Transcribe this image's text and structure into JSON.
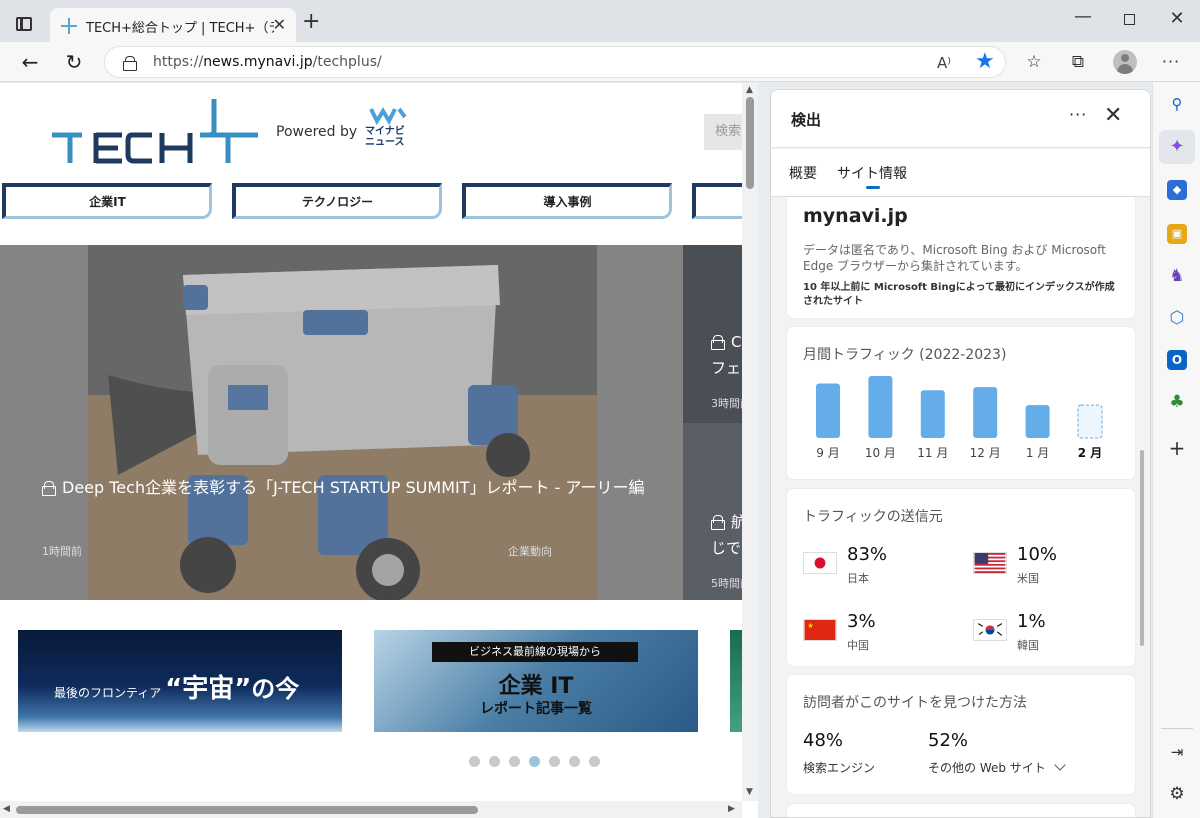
{
  "window": {
    "tab_title": "TECH+総合トップ | TECH+（テック）",
    "new_tab": "+",
    "close_tab": "✕"
  },
  "address_bar": {
    "url_prefix": "https://",
    "url_domain": "news.mynavi.jp",
    "url_path": "/techplus/",
    "read_aloud": "A⁾"
  },
  "webpage": {
    "logo_alt": "TECH+",
    "powered_by": "Powered by",
    "mynavi_logo_text": "マイナビ\nニュース",
    "search_label": "検索",
    "categories": [
      "企業IT",
      "テクノロジー",
      "導入事例",
      ""
    ],
    "hero": {
      "title": "Deep Tech企業を表彰する「J-TECH STARTUP SUMMIT」レポート - アーリー編",
      "time": "1時間前",
      "category": "企業動向"
    },
    "side_items": [
      {
        "title_line1": "C",
        "title_line2": "フェ",
        "time": "3時間前"
      },
      {
        "title_line1": "航",
        "title_line2": "じで",
        "time": "5時間前"
      }
    ],
    "banners": [
      {
        "pre": "最後のフロンティア",
        "title": "“宇宙”",
        "post": "の今"
      },
      {
        "top": "ビジネス最前線の現場から",
        "title": "企業 IT",
        "sub": "レポート記事一覧"
      }
    ],
    "carousel": {
      "count": 7,
      "active": 3
    }
  },
  "panel": {
    "title": "検出",
    "tabs": [
      "概要",
      "サイト情報"
    ],
    "active_tab": 1,
    "site": {
      "name": "mynavi.jp",
      "description": "データは匿名であり、Microsoft Bing および Microsoft Edge ブラウザーから集計されています。",
      "index_note": "10 年以上前に Microsoft Bingによって最初にインデックスが作成されたサイト"
    },
    "traffic_title": "月間トラフィック (2022-2023)",
    "sources_title": "トラフィックの送信元",
    "sources": [
      {
        "pct": "83%",
        "country": "日本",
        "flag": "jp-flag-icon"
      },
      {
        "pct": "10%",
        "country": "米国",
        "flag": "us-flag-icon"
      },
      {
        "pct": "3%",
        "country": "中国",
        "flag": "cn-flag-icon"
      },
      {
        "pct": "1%",
        "country": "韓国",
        "flag": "kr-flag-icon"
      }
    ],
    "visitors_title": "訪問者がこのサイトを見つけた方法",
    "visitors": [
      {
        "pct": "48%",
        "label": "検索エンジン"
      },
      {
        "pct": "52%",
        "label": "その他の Web サイト"
      }
    ]
  },
  "chart_data": {
    "type": "bar",
    "title": "月間トラフィック (2022-2023)",
    "categories": [
      "9 月",
      "10 月",
      "11 月",
      "12 月",
      "1 月",
      "2 月"
    ],
    "values": [
      0.88,
      1.0,
      0.77,
      0.82,
      0.53,
      0.53
    ],
    "partial": [
      false,
      false,
      false,
      false,
      false,
      true
    ],
    "bar_color": "#64ade8",
    "ylim": [
      0,
      1
    ]
  },
  "colors": {
    "accent": "#0f6cbd",
    "star": "#1a73e8",
    "tech_navy": "#1e3a5f",
    "tech_light": "#9fc3dc"
  }
}
